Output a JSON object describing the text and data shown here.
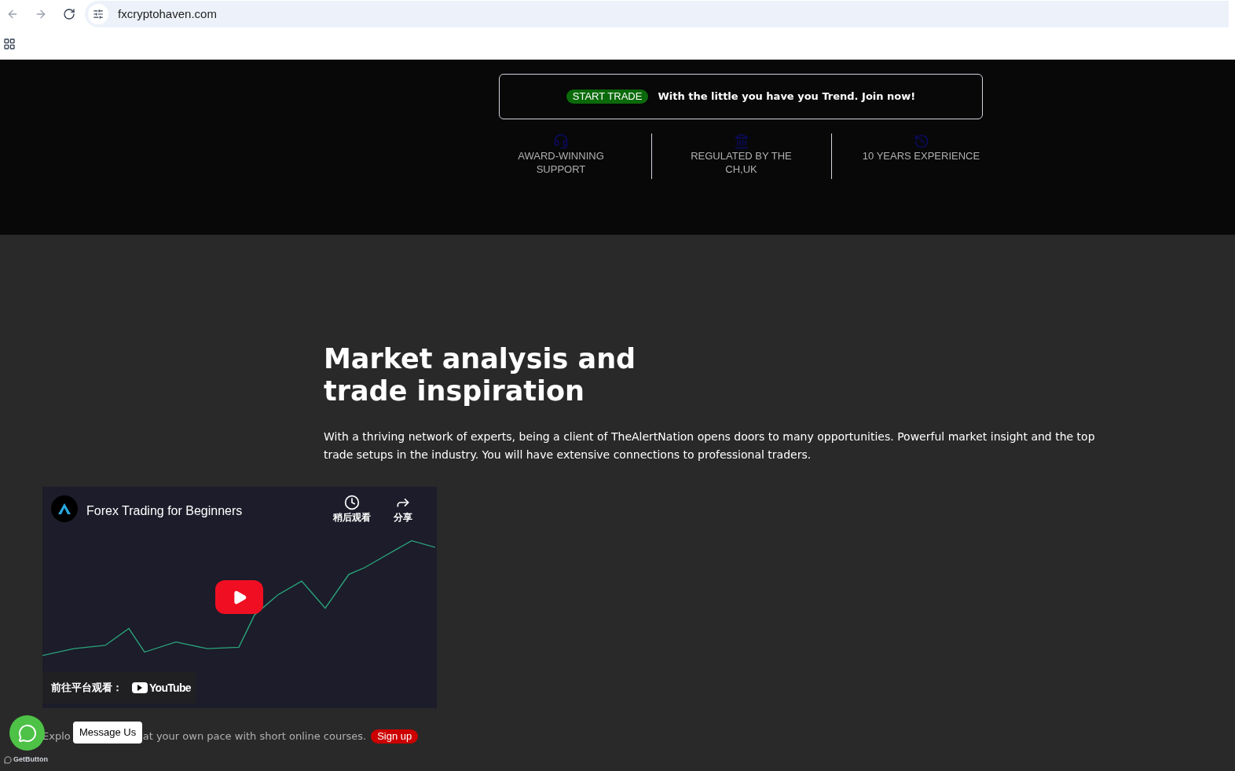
{
  "browser": {
    "url": "fxcryptohaven.com"
  },
  "promo": {
    "badge": "START TRADE",
    "text": "With the little you have you Trend. Join now!"
  },
  "features": [
    {
      "kind": "support",
      "label": "AWARD-WINNING SUPPORT"
    },
    {
      "kind": "regulated",
      "label": "REGULATED BY THE CH,UK"
    },
    {
      "kind": "experience",
      "label": "10 YEARS EXPERIENCE"
    }
  ],
  "section": {
    "heading": "Market analysis and trade inspiration",
    "body": "With a thriving network of experts, being a client of TheAlertNation opens doors to many opportunities. Powerful market insight and the top trade setups in the industry. You will have extensive connections to professional traders."
  },
  "video": {
    "title": "Forex Trading for Beginners",
    "watch_later": "稍后观看",
    "share": "分享",
    "watch_on": "前往平台观看：",
    "platform": "YouTube"
  },
  "courses": {
    "text_before": "Explo",
    "text_after": "at your own pace with short online courses.",
    "button": "Sign up"
  },
  "chat_widget": {
    "tooltip": "Message Us",
    "brand": "GetButton"
  }
}
